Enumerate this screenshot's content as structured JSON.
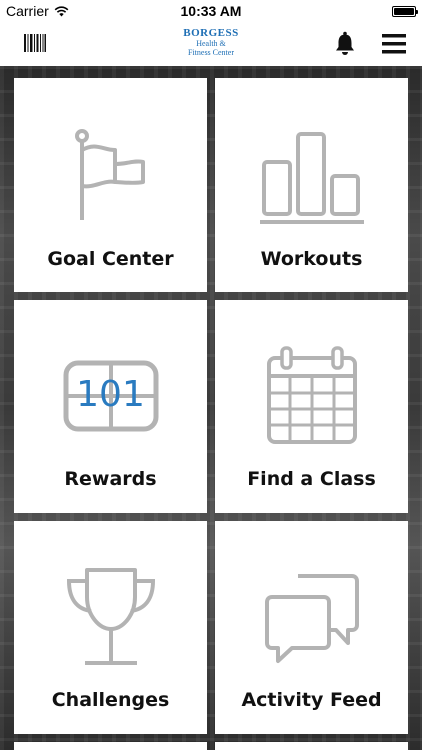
{
  "status_bar": {
    "carrier": "Carrier",
    "time": "10:33 AM"
  },
  "nav": {
    "logo_main": "BORGESS",
    "logo_sub_line1": "Health &",
    "logo_sub_line2": "Fitness Center",
    "barcode_icon": "barcode-icon",
    "bell_icon": "bell-icon",
    "menu_icon": "hamburger-menu-icon"
  },
  "tiles": [
    {
      "label": "Goal Center",
      "icon": "flag-icon"
    },
    {
      "label": "Workouts",
      "icon": "bar-chart-icon"
    },
    {
      "label": "Rewards",
      "icon": "scoreboard-icon",
      "icon_text": "101"
    },
    {
      "label": "Find a Class",
      "icon": "calendar-icon"
    },
    {
      "label": "Challenges",
      "icon": "trophy-icon"
    },
    {
      "label": "Activity Feed",
      "icon": "chat-bubbles-icon"
    }
  ],
  "colors": {
    "brand_blue": "#1f6fb5",
    "icon_gray": "#b3b3b3",
    "tile_bg": "#ffffff",
    "label_text": "#111111"
  }
}
